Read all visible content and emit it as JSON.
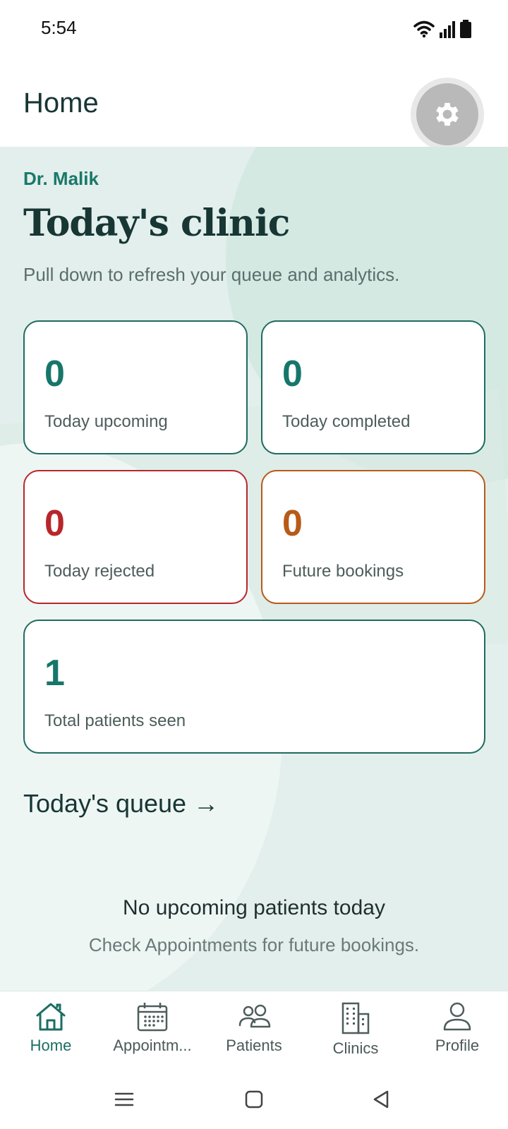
{
  "status_bar": {
    "time": "5:54",
    "icons": [
      "wifi-icon",
      "signal-icon",
      "battery-icon"
    ]
  },
  "header": {
    "title": "Home",
    "settings_icon": "gear-icon"
  },
  "hero": {
    "doctor_name": "Dr. Malik",
    "title": "Today's clinic",
    "subtitle": "Pull down to refresh your queue and analytics."
  },
  "stats": {
    "upcoming": {
      "value": "0",
      "label": "Today upcoming",
      "color": "#17766a"
    },
    "completed": {
      "value": "0",
      "label": "Today completed",
      "color": "#17766a"
    },
    "rejected": {
      "value": "0",
      "label": "Today rejected",
      "color": "#b8262b"
    },
    "future": {
      "value": "0",
      "label": "Future bookings",
      "color": "#b85a17"
    },
    "total": {
      "value": "1",
      "label": "Total patients seen",
      "color": "#17766a"
    }
  },
  "queue": {
    "link_label": "Today's queue →",
    "empty_title": "No upcoming patients today",
    "empty_subtitle": "Check Appointments for future bookings."
  },
  "bottom_nav": {
    "items": [
      {
        "label": "Home",
        "icon": "home-icon",
        "active": true
      },
      {
        "label": "Appointm...",
        "icon": "calendar-icon",
        "active": false
      },
      {
        "label": "Patients",
        "icon": "people-icon",
        "active": false
      },
      {
        "label": "Clinics",
        "icon": "building-icon",
        "active": false
      },
      {
        "label": "Profile",
        "icon": "person-icon",
        "active": false
      }
    ]
  },
  "system_nav": [
    "menu-icon",
    "home-square-icon",
    "back-triangle-icon"
  ],
  "colors": {
    "accent": "#1b6e63",
    "title": "#173634",
    "background": "#e3efec"
  }
}
